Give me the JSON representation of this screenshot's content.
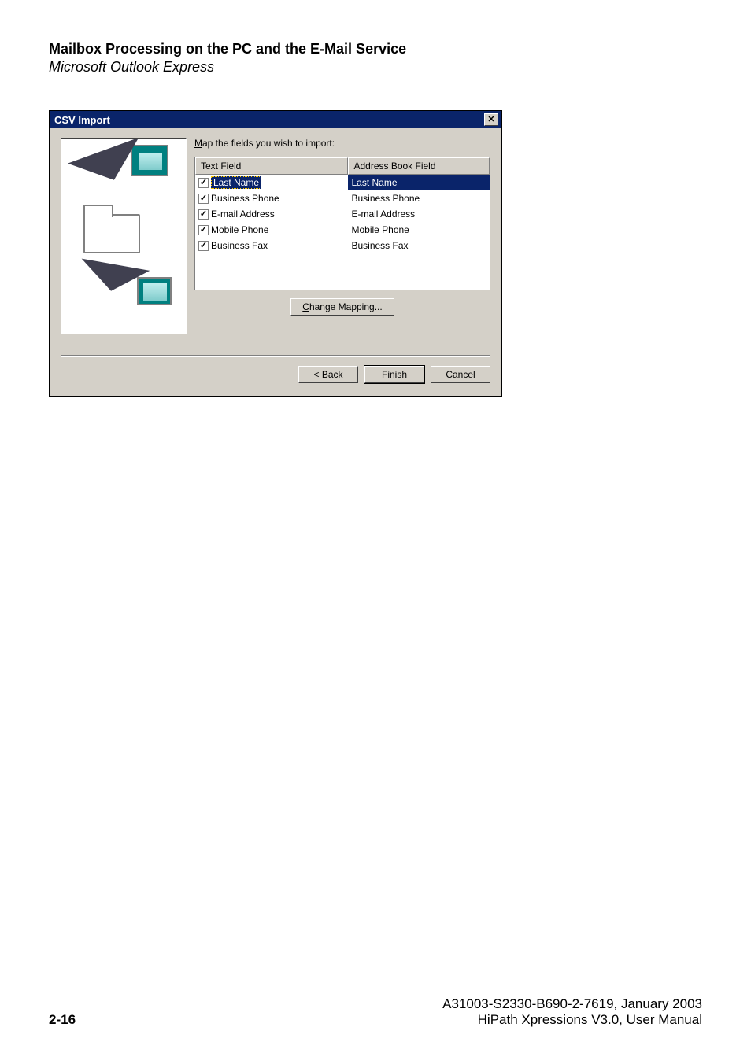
{
  "header": {
    "title": "Mailbox Processing on the PC and the E-Mail Service",
    "subtitle": "Microsoft Outlook Express"
  },
  "dialog": {
    "title": "CSV Import",
    "close_glyph": "✕",
    "instruction_prefix": "M",
    "instruction_rest": "ap the fields you wish to import:",
    "columns": {
      "text_field": "Text Field",
      "abf": "Address Book Field"
    },
    "rows": [
      {
        "checked": true,
        "text_field": "Last Name",
        "abf": "Last Name",
        "selected": true
      },
      {
        "checked": true,
        "text_field": "Business Phone",
        "abf": "Business Phone",
        "selected": false
      },
      {
        "checked": true,
        "text_field": "E-mail Address",
        "abf": "E-mail Address",
        "selected": false
      },
      {
        "checked": true,
        "text_field": "Mobile Phone",
        "abf": "Mobile Phone",
        "selected": false
      },
      {
        "checked": true,
        "text_field": "Business Fax",
        "abf": "Business Fax",
        "selected": false
      }
    ],
    "buttons": {
      "change_prefix": "C",
      "change_rest": "hange Mapping...",
      "back_prefix": "< ",
      "back_u": "B",
      "back_rest": "ack",
      "finish": "Finish",
      "cancel": "Cancel"
    }
  },
  "footer": {
    "page_num": "2-16",
    "line1": "A31003-S2330-B690-2-7619, January 2003",
    "line2": "HiPath Xpressions V3.0, User Manual"
  }
}
